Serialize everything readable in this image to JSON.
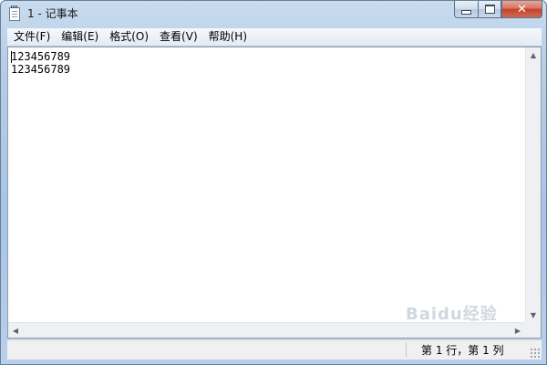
{
  "window": {
    "title": "1 - 记事本",
    "controls": {
      "minimize": "minimize-icon",
      "maximize": "maximize-icon",
      "close": "close-icon",
      "close_glyph": "✕"
    }
  },
  "menu": {
    "items": [
      {
        "label": "文件(F)"
      },
      {
        "label": "编辑(E)"
      },
      {
        "label": "格式(O)"
      },
      {
        "label": "查看(V)"
      },
      {
        "label": "帮助(H)"
      }
    ]
  },
  "editor": {
    "lines": [
      "123456789",
      "123456789"
    ]
  },
  "scrollbar": {
    "up": "▲",
    "down": "▼",
    "left": "◀",
    "right": "▶"
  },
  "status": {
    "position": "第 1 行，第 1 列"
  },
  "watermark": {
    "text": "Baidu经验"
  },
  "colors": {
    "title_bar": "#b5cde6",
    "close_button": "#c4412a",
    "editor_bg": "#ffffff",
    "status_bg": "#f0f0f0"
  }
}
